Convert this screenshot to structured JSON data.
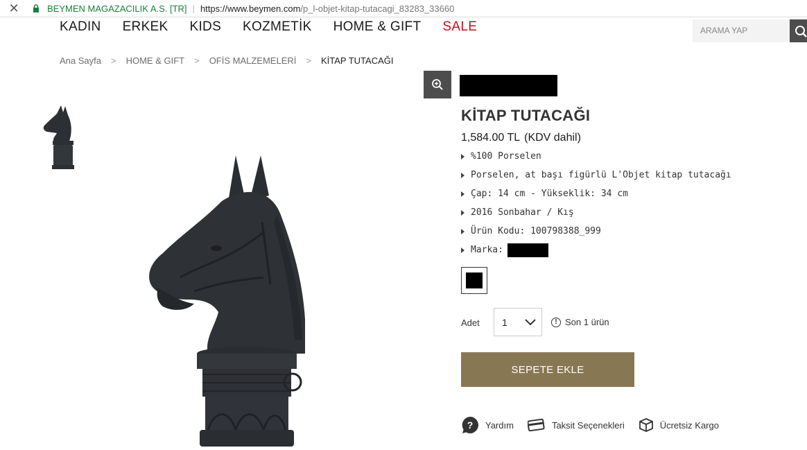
{
  "browser": {
    "site_identity": "BEYMEN MAGAZACILIK A.S. [TR]",
    "url_host": "https://www.beymen.com",
    "url_path": "/p_l-objet-kitap-tutacagi_83283_33660"
  },
  "nav": {
    "items": [
      "KADIN",
      "ERKEK",
      "KIDS",
      "KOZMETİK",
      "HOME & GIFT"
    ],
    "sale": "SALE"
  },
  "search": {
    "placeholder": "ARAMA YAP"
  },
  "breadcrumb": [
    "Ana Sayfa",
    "HOME & GIFT",
    "OFİS MALZEMELERİ",
    "KİTAP TUTACAĞI"
  ],
  "product": {
    "title": "KİTAP TUTACAĞI",
    "price": "1,584.00 TL",
    "vat": "(KDV dahil)",
    "specs": [
      "%100 Porselen",
      "Porselen, at başı figürlü L'Objet kitap tutacağı",
      "Çap: 14 cm - Yükseklik: 34 cm",
      "2016 Sonbahar / Kış",
      "Ürün Kodu: 100798388_999"
    ],
    "brand_label": "Marka:",
    "swatch_color": "#000000",
    "qty_label": "Adet",
    "qty_value": "1",
    "stock_note": "Son 1 ürün",
    "add_to_cart": "SEPETE EKLE",
    "accent_color": "#887753"
  },
  "helpers": {
    "help": "Yardım",
    "installments": "Taksit Seçenekleri",
    "shipping": "Ücretsiz Kargo"
  }
}
